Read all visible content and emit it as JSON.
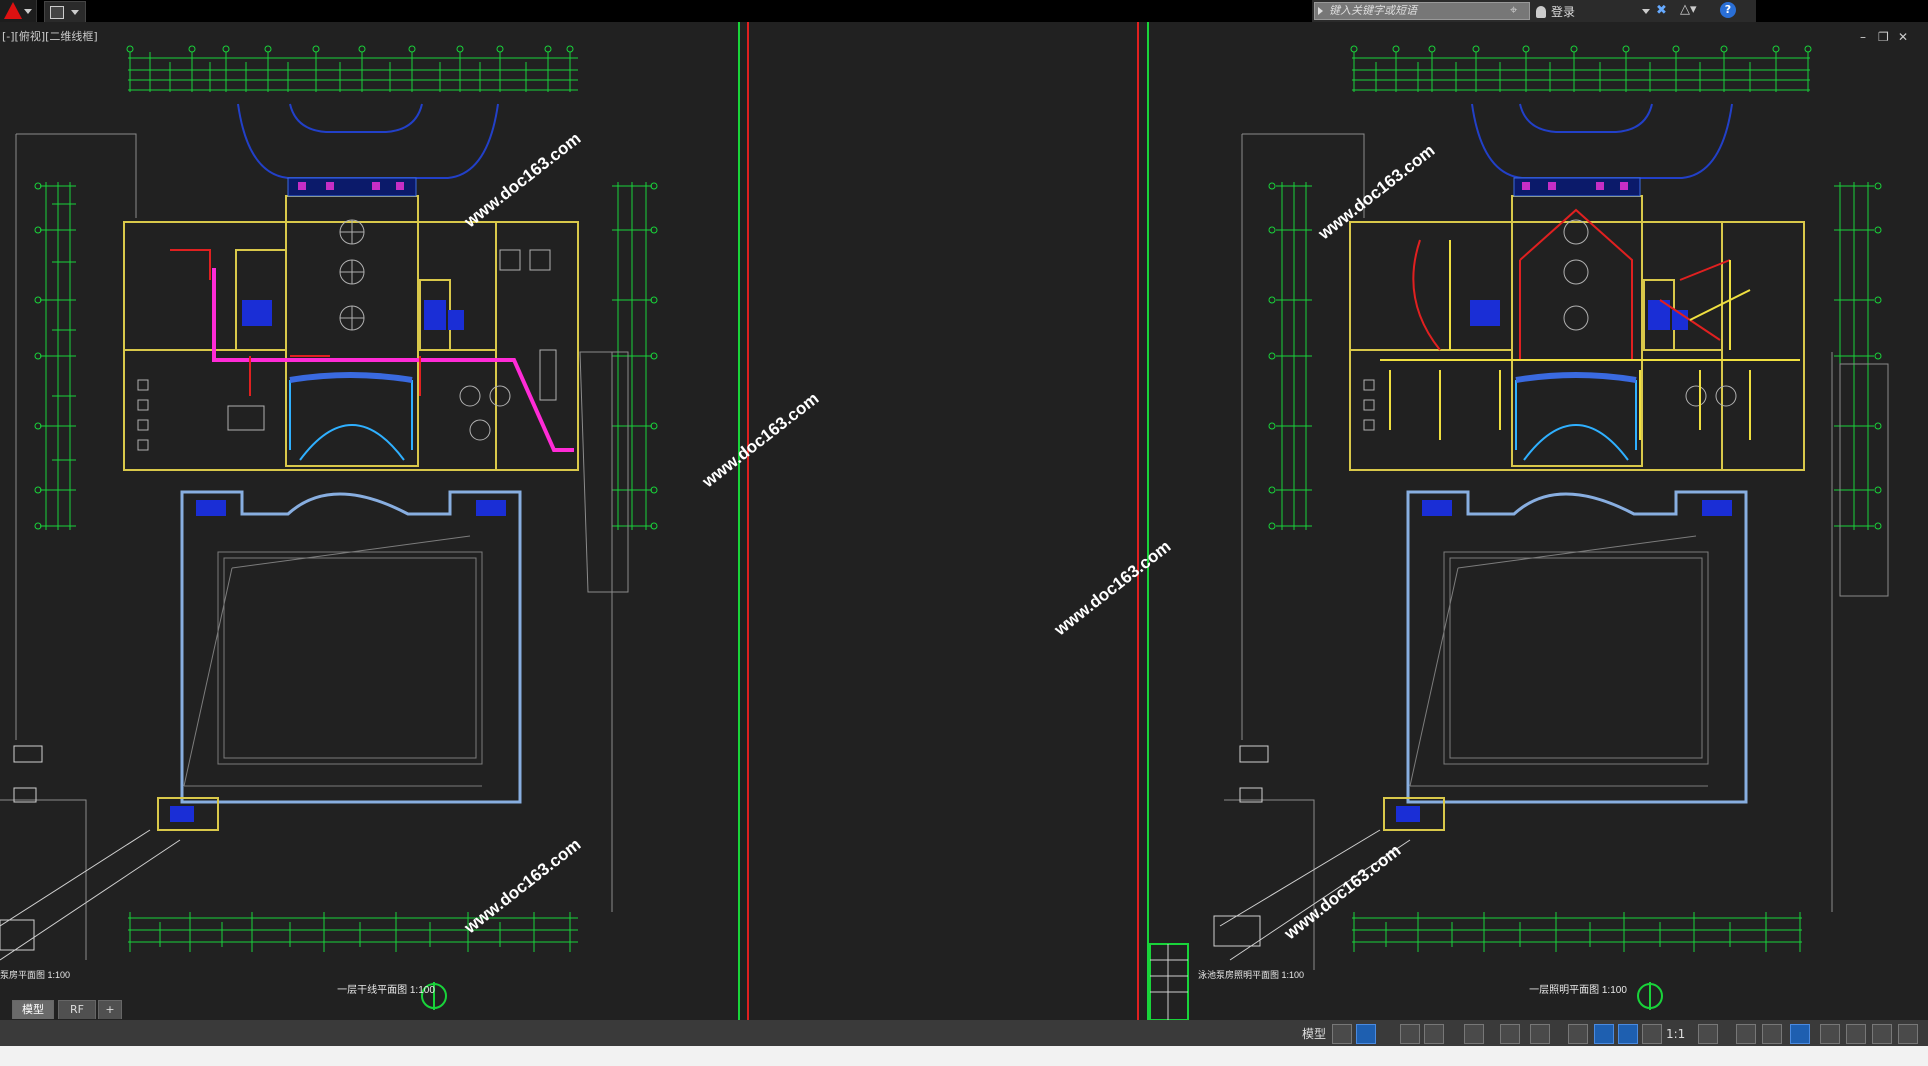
{
  "titlebar": {
    "search_placeholder": "键入关键字或短语",
    "login_label": "登录",
    "help_label": "?"
  },
  "viewport": {
    "label": "[-][俯视][二维线框]",
    "win_minimize": "–",
    "win_restore": "❐",
    "win_close": "✕"
  },
  "drawing": {
    "left_title": "一层干线平面图  1:100",
    "right_title": "一层照明平面图  1:100",
    "left_partial_title": "泵房平面图  1:100",
    "right_partial_title": "泳池泵房照明平面图  1:100",
    "watermark": "www.doc163.com"
  },
  "tabs": [
    {
      "label": "模型",
      "active": true
    },
    {
      "label": "RF",
      "active": false
    },
    {
      "label": "+",
      "active": false
    }
  ],
  "statusbar": {
    "model_label": "模型",
    "scale_label": "1:1"
  },
  "colors": {
    "canvas": "#212121",
    "dim_green": "#19d33a",
    "wall_yellow": "#d9c84a",
    "pink_line": "#ff2bd6",
    "red_line": "#e02020",
    "blue_pool": "#88aee0"
  }
}
